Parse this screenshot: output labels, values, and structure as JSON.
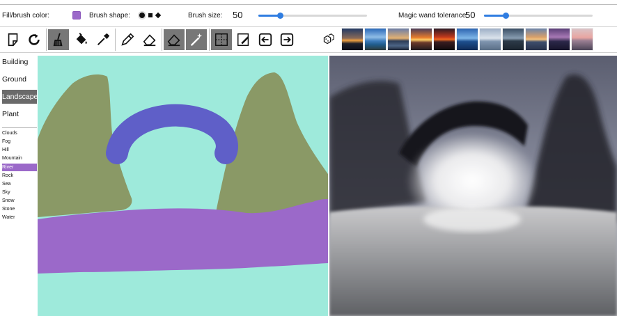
{
  "controls": {
    "fill_label": "Fill/brush color:",
    "fill_color": "#9b69c9",
    "shape_label": "Brush shape:",
    "shapes": [
      "circle",
      "square",
      "diamond"
    ],
    "selected_shape": "circle",
    "size_label": "Brush size:",
    "size_value": "50",
    "size_fraction": 0.2,
    "wand_label": "Magic wand tolerance:",
    "wand_value": "50",
    "wand_fraction": 0.2,
    "slider_color": "#2f7de1"
  },
  "toolbar": {
    "tools": [
      {
        "name": "new-canvas-icon",
        "active": false
      },
      {
        "name": "reset-icon",
        "active": false
      },
      {
        "name": "broom-clear-icon",
        "active": true
      },
      {
        "name": "paint-bucket-icon",
        "active": false
      },
      {
        "name": "eyedropper-icon",
        "active": false
      },
      {
        "name": "pencil-icon",
        "active": false
      },
      {
        "name": "eraser-icon",
        "active": false
      },
      {
        "name": "eraser-fill-icon",
        "active": true
      },
      {
        "name": "magic-wand-icon",
        "active": true
      },
      {
        "name": "grid-select-icon",
        "active": true
      },
      {
        "name": "pen-select-icon",
        "active": false
      },
      {
        "name": "undo-arrow-icon",
        "active": false
      },
      {
        "name": "redo-arrow-icon",
        "active": false
      },
      {
        "name": "random-dice-icon",
        "active": false
      }
    ],
    "style_thumbnails": [
      "sunset-dark-thumbnail",
      "lake-blue-thumbnail",
      "coast-sunset-thumbnail",
      "orange-sunset-thumbnail",
      "red-sunset-thumbnail",
      "ocean-blue-thumbnail",
      "misty-lake-thumbnail",
      "dusk-sea-thumbnail",
      "cloudy-sunset-thumbnail",
      "beach-purple-thumbnail",
      "pink-horizon-thumbnail"
    ]
  },
  "categories": [
    {
      "label": "Building",
      "selected": false
    },
    {
      "label": "Ground",
      "selected": false
    },
    {
      "label": "Landscape",
      "selected": true
    },
    {
      "label": "Plant",
      "selected": false
    }
  ],
  "labels": [
    {
      "label": "Clouds",
      "selected": false
    },
    {
      "label": "Fog",
      "selected": false
    },
    {
      "label": "Hill",
      "selected": false
    },
    {
      "label": "Mountain",
      "selected": false
    },
    {
      "label": "River",
      "selected": true
    },
    {
      "label": "Rock",
      "selected": false
    },
    {
      "label": "Sea",
      "selected": false
    },
    {
      "label": "Sky",
      "selected": false
    },
    {
      "label": "Snow",
      "selected": false
    },
    {
      "label": "Stone",
      "selected": false
    },
    {
      "label": "Water",
      "selected": false
    }
  ],
  "segmentation_colors": {
    "sky": "#9eeadb",
    "mountain": "#8a9966",
    "bridge": "#5f5fc8",
    "river": "#9b69c9"
  }
}
